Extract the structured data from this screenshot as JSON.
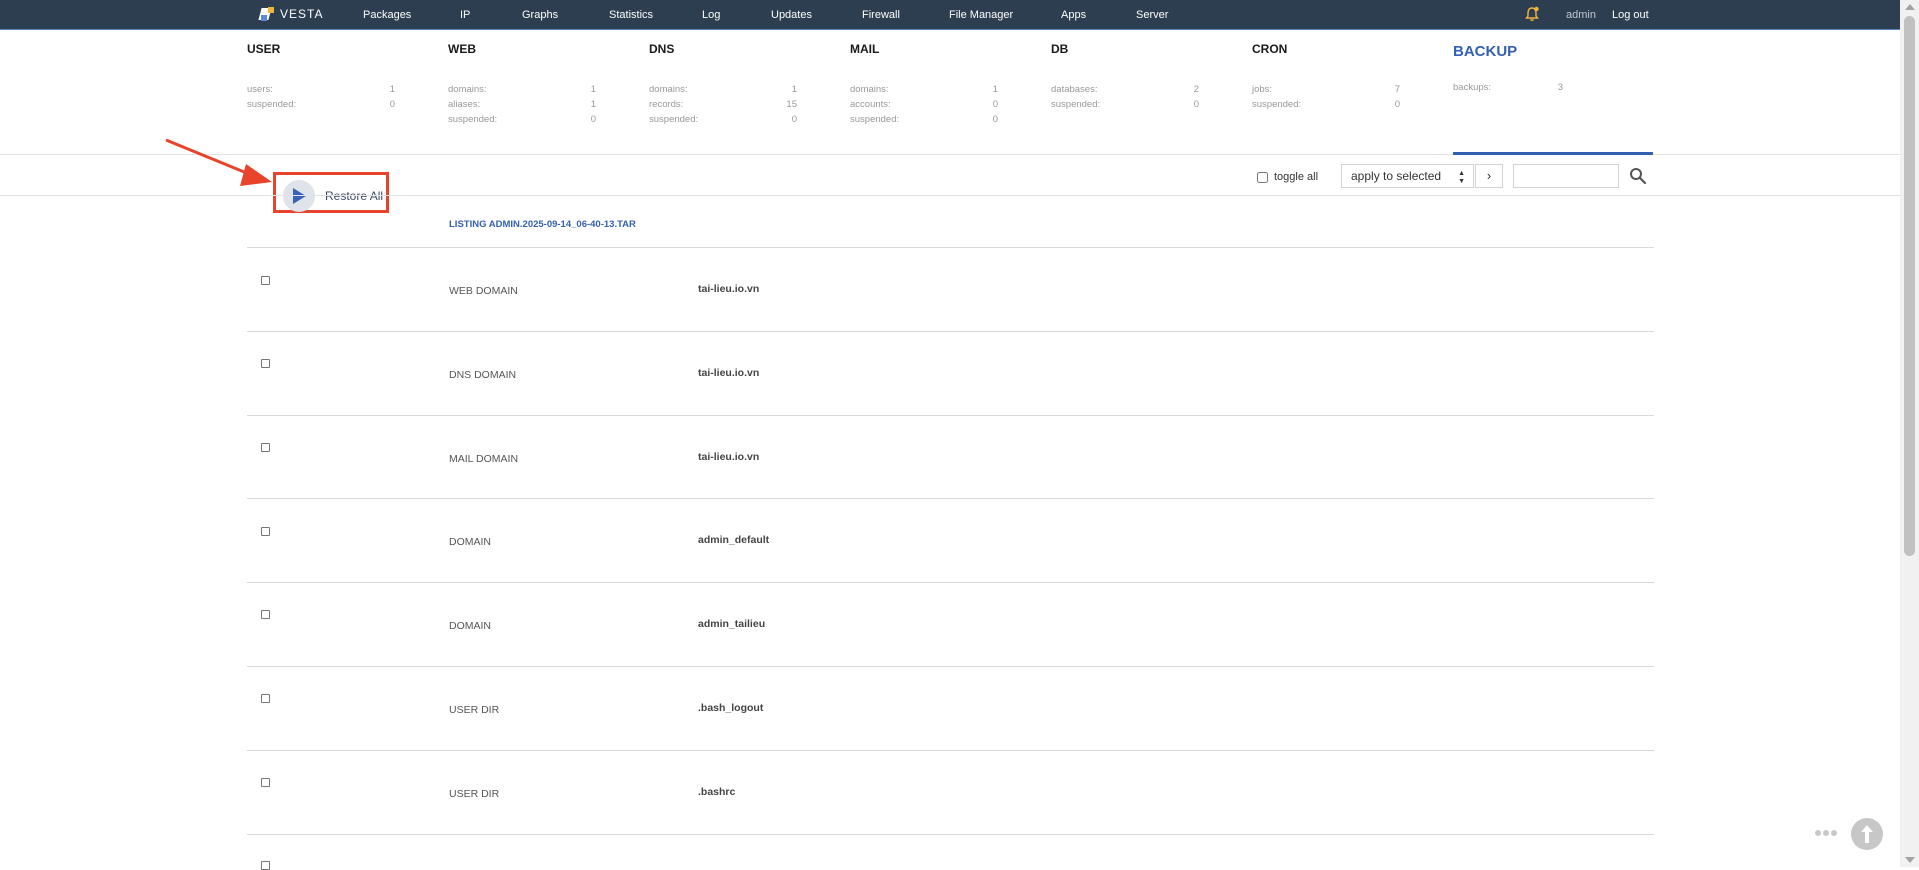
{
  "nav": {
    "logo": "VESTA",
    "items": [
      "Packages",
      "IP",
      "Graphs",
      "Statistics",
      "Log",
      "Updates",
      "Firewall",
      "File Manager",
      "Apps",
      "Server"
    ],
    "user": "admin",
    "logout": "Log out"
  },
  "stats": {
    "user": {
      "title": "USER",
      "rows": [
        {
          "label": "users:",
          "value": "1"
        },
        {
          "label": "suspended:",
          "value": "0"
        }
      ]
    },
    "web": {
      "title": "WEB",
      "rows": [
        {
          "label": "domains:",
          "value": "1"
        },
        {
          "label": "aliases:",
          "value": "1"
        },
        {
          "label": "suspended:",
          "value": "0"
        }
      ]
    },
    "dns": {
      "title": "DNS",
      "rows": [
        {
          "label": "domains:",
          "value": "1"
        },
        {
          "label": "records:",
          "value": "15"
        },
        {
          "label": "suspended:",
          "value": "0"
        }
      ]
    },
    "mail": {
      "title": "MAIL",
      "rows": [
        {
          "label": "domains:",
          "value": "1"
        },
        {
          "label": "accounts:",
          "value": "0"
        },
        {
          "label": "suspended:",
          "value": "0"
        }
      ]
    },
    "db": {
      "title": "DB",
      "rows": [
        {
          "label": "databases:",
          "value": "2"
        },
        {
          "label": "suspended:",
          "value": "0"
        }
      ]
    },
    "cron": {
      "title": "CRON",
      "rows": [
        {
          "label": "jobs:",
          "value": "7"
        },
        {
          "label": "suspended:",
          "value": "0"
        }
      ]
    },
    "backup": {
      "title": "BACKUP",
      "rows": [
        {
          "label": "backups:",
          "value": "3"
        }
      ]
    }
  },
  "toolbar": {
    "restore_all": "Restore All",
    "toggle_all": "toggle all",
    "apply_selected": "apply to selected",
    "go": "›",
    "search_placeholder": ""
  },
  "listing": {
    "title": "LISTING ADMIN.2025-09-14_06-40-13.TAR",
    "rows": [
      {
        "type": "WEB DOMAIN",
        "name": "tai-lieu.io.vn"
      },
      {
        "type": "DNS DOMAIN",
        "name": "tai-lieu.io.vn"
      },
      {
        "type": "MAIL DOMAIN",
        "name": "tai-lieu.io.vn"
      },
      {
        "type": "DOMAIN",
        "name": "admin_default"
      },
      {
        "type": "DOMAIN",
        "name": "admin_tailieu"
      },
      {
        "type": "USER DIR",
        "name": ".bash_logout"
      },
      {
        "type": "USER DIR",
        "name": ".bashrc"
      }
    ]
  },
  "colors": {
    "topbar": "#2c3e50",
    "accent": "#3560b0",
    "highlight": "#e8442b",
    "bell": "#f3b43c"
  },
  "icons": {
    "restore": "play-icon",
    "search": "search-icon",
    "notification": "bell-icon",
    "scroll_top": "arrow-up-icon"
  }
}
